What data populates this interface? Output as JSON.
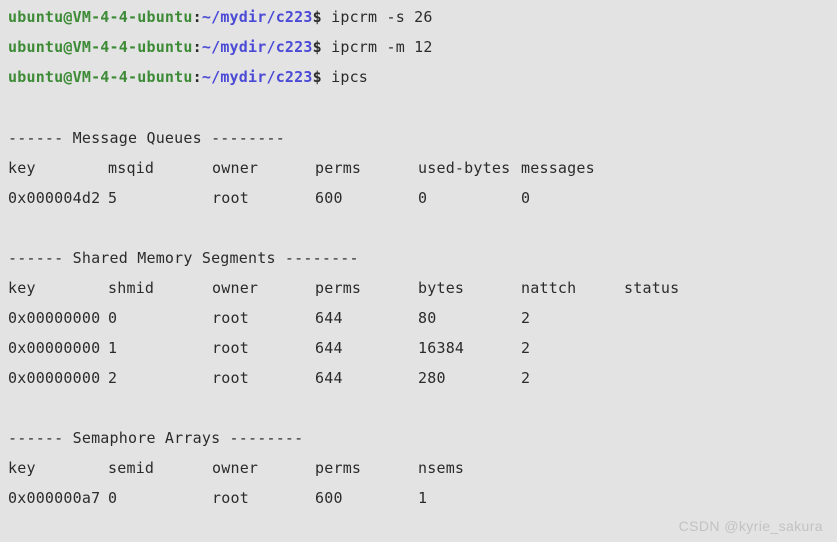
{
  "terminal": {
    "background_color": "#e3e3e3",
    "text_color": "#2b2b2b",
    "prompt_user_color": "#3d8b36",
    "prompt_path_color": "#4a4ad6",
    "prompt_user_host": "ubuntu@VM-4-4-ubuntu",
    "prompt_colon": ":",
    "prompt_path": "~/mydir/c223",
    "prompt_symbol": "$",
    "commands": [
      "ipcrm -s 26",
      "ipcrm -m 12",
      "ipcs"
    ],
    "sections": [
      {
        "title": "------ Message Queues --------",
        "headers": [
          "key",
          "msqid",
          "owner",
          "perms",
          "used-bytes",
          "messages"
        ],
        "rows": [
          [
            "0x000004d2",
            "5",
            "root",
            "600",
            "0",
            "0"
          ]
        ]
      },
      {
        "title": "------ Shared Memory Segments --------",
        "headers": [
          "key",
          "shmid",
          "owner",
          "perms",
          "bytes",
          "nattch",
          "status"
        ],
        "rows": [
          [
            "0x00000000",
            "0",
            "root",
            "644",
            "80",
            "2",
            ""
          ],
          [
            "0x00000000",
            "1",
            "root",
            "644",
            "16384",
            "2",
            ""
          ],
          [
            "0x00000000",
            "2",
            "root",
            "644",
            "280",
            "2",
            ""
          ]
        ]
      },
      {
        "title": "------ Semaphore Arrays --------",
        "headers": [
          "key",
          "semid",
          "owner",
          "perms",
          "nsems"
        ],
        "rows": [
          [
            "0x000000a7",
            "0",
            "root",
            "600",
            "1"
          ]
        ]
      }
    ]
  },
  "watermark": {
    "text": "CSDN @kyrie_sakura",
    "color": "#c2c2c2"
  }
}
